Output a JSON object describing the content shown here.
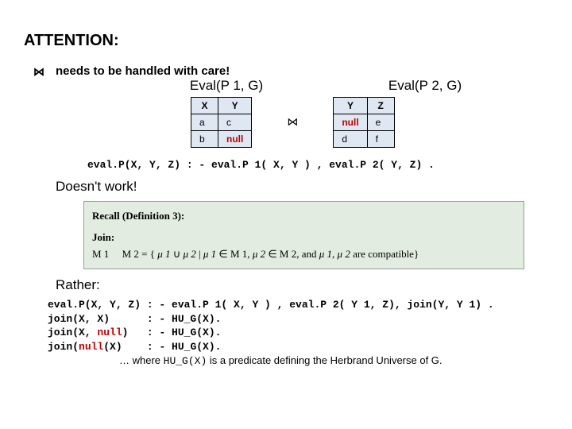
{
  "title": "ATTENTION:",
  "care_line": "needs to be handled with care!",
  "bowtie": "⋈",
  "eval1_label": "Eval(P 1, G)",
  "eval2_label": "Eval(P 2, G)",
  "t1": {
    "h1": "X",
    "h2": "Y",
    "r1c1": "a",
    "r1c2": "c",
    "r2c1": "b",
    "r2c2": "null"
  },
  "t2": {
    "h1": "Y",
    "h2": "Z",
    "r1c1": "null",
    "r1c2": "e",
    "r2c1": "d",
    "r2c2": "f"
  },
  "code1": "eval.P(X, Y, Z) : - eval.P 1( X, Y ) , eval.P 2( Y, Z) .",
  "doesnt": "Doesn't work!",
  "recall_header": "Recall (Definition 3):",
  "join_label": "Join:",
  "join_lhs": "M 1",
  "join_rhs_prefix": "M 2 = { ",
  "mu1": "μ 1",
  "mu2": "μ 2",
  "union": "∪",
  "elem": "∈",
  "join_mid1": " | ",
  "join_mid2": " M 1, ",
  "join_mid3": "M 2, and ",
  "compat": " are compatible}",
  "rather": "Rather:",
  "code2_l1": "eval.P(X, Y, Z) : - eval.P 1( X, Y ) , eval.P 2( Y 1, Z), join(Y, Y 1) .",
  "code2_l2": "join(X, X)      : - HU_G(X).",
  "code2_l3": "join(X, null)   : - HU_G(X).",
  "code2_l4": "join(null(X)    : - HU_G(X).",
  "note_prefix": "… where ",
  "note_pred": "HU_G(X)",
  "note_suffix": "  is a predicate defining the Herbrand Universe of G."
}
